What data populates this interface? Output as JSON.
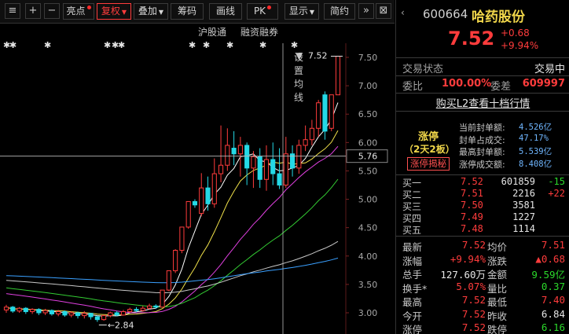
{
  "toolbar": {
    "icons": [
      "≡",
      "+",
      "−"
    ],
    "buttons": [
      {
        "label": "亮点",
        "dot": true
      },
      {
        "label": "复权",
        "active": true,
        "caret": true
      },
      {
        "label": "叠加",
        "caret": true
      },
      {
        "label": "筹码"
      },
      {
        "label": "画线"
      },
      {
        "label": "PK",
        "dot": true
      },
      {
        "label": "显示",
        "caret": true
      },
      {
        "label": "简约"
      }
    ],
    "more": "»",
    "window_icon": "⊠"
  },
  "subbar": {
    "items": [
      "沪股通",
      "融资融券",
      "设置均线"
    ]
  },
  "chart_data": {
    "type": "candlestick",
    "ylim": [
      2.8,
      7.7
    ],
    "y_ticks": [
      "7.50",
      "7.00",
      "6.50",
      "6.00",
      "5.50",
      "5.00",
      "4.50",
      "4.00",
      "3.50",
      "3.00"
    ],
    "crosshair_price": "5.76",
    "high_label": "7.52",
    "low_label": "2.84",
    "event_markers": "✱✱",
    "colors": {
      "up": "#ff3c3c",
      "down": "#24d9e6",
      "ma5": "#ffffff",
      "ma10": "#f0e14a",
      "ma20": "#e040e0",
      "ma30": "#33cc33",
      "ma60": "#c8c8c8",
      "ma120": "#3aa0ff"
    },
    "candles": [
      {
        "o": 3.05,
        "c": 3.1,
        "h": 3.14,
        "l": 3.0
      },
      {
        "o": 3.1,
        "c": 3.03,
        "h": 3.12,
        "l": 3.0
      },
      {
        "o": 3.03,
        "c": 3.08,
        "h": 3.1,
        "l": 3.0
      },
      {
        "o": 3.08,
        "c": 3.02,
        "h": 3.1,
        "l": 2.98
      },
      {
        "o": 3.02,
        "c": 3.06,
        "h": 3.08,
        "l": 2.98
      },
      {
        "o": 3.06,
        "c": 3.0,
        "h": 3.08,
        "l": 2.96
      },
      {
        "o": 3.0,
        "c": 3.04,
        "h": 3.07,
        "l": 2.96
      },
      {
        "o": 3.04,
        "c": 2.98,
        "h": 3.06,
        "l": 2.95
      },
      {
        "o": 2.98,
        "c": 3.02,
        "h": 3.05,
        "l": 2.94
      },
      {
        "o": 3.02,
        "c": 2.96,
        "h": 3.04,
        "l": 2.93
      },
      {
        "o": 2.96,
        "c": 3.0,
        "h": 3.03,
        "l": 2.92
      },
      {
        "o": 3.0,
        "c": 2.95,
        "h": 3.02,
        "l": 2.9
      },
      {
        "o": 2.95,
        "c": 2.99,
        "h": 3.03,
        "l": 2.9
      },
      {
        "o": 2.99,
        "c": 2.93,
        "h": 3.0,
        "l": 2.88
      },
      {
        "o": 2.93,
        "c": 2.88,
        "h": 2.95,
        "l": 2.84
      },
      {
        "o": 2.88,
        "c": 2.95,
        "h": 2.97,
        "l": 2.86
      },
      {
        "o": 2.95,
        "c": 3.0,
        "h": 3.02,
        "l": 2.92
      },
      {
        "o": 3.0,
        "c": 2.96,
        "h": 3.03,
        "l": 2.94
      },
      {
        "o": 2.96,
        "c": 3.02,
        "h": 3.05,
        "l": 2.95
      },
      {
        "o": 3.02,
        "c": 3.06,
        "h": 3.09,
        "l": 3.0
      },
      {
        "o": 3.06,
        "c": 3.04,
        "h": 3.1,
        "l": 3.01
      },
      {
        "o": 3.04,
        "c": 3.08,
        "h": 3.12,
        "l": 3.02
      },
      {
        "o": 3.08,
        "c": 3.12,
        "h": 3.16,
        "l": 3.06
      },
      {
        "o": 3.12,
        "c": 3.1,
        "h": 3.15,
        "l": 3.07
      },
      {
        "o": 3.1,
        "c": 3.4,
        "h": 3.4,
        "l": 3.09
      },
      {
        "o": 3.4,
        "c": 3.74,
        "h": 3.74,
        "l": 3.38
      },
      {
        "o": 3.74,
        "c": 4.1,
        "h": 4.12,
        "l": 3.7
      },
      {
        "o": 4.1,
        "c": 4.51,
        "h": 4.51,
        "l": 4.05
      },
      {
        "o": 4.51,
        "c": 4.96,
        "h": 4.96,
        "l": 4.48
      },
      {
        "o": 4.96,
        "c": 4.9,
        "h": 5.0,
        "l": 4.85
      },
      {
        "o": 4.75,
        "c": 5.2,
        "h": 5.46,
        "l": 4.7
      },
      {
        "o": 5.2,
        "c": 4.92,
        "h": 5.4,
        "l": 4.8
      },
      {
        "o": 4.92,
        "c": 5.45,
        "h": 5.72,
        "l": 4.85
      },
      {
        "o": 5.45,
        "c": 5.6,
        "h": 6.3,
        "l": 5.3
      },
      {
        "o": 5.6,
        "c": 5.95,
        "h": 6.25,
        "l": 5.5
      },
      {
        "o": 5.9,
        "c": 5.8,
        "h": 6.2,
        "l": 5.6
      },
      {
        "o": 5.8,
        "c": 5.95,
        "h": 6.1,
        "l": 5.4
      },
      {
        "o": 5.95,
        "c": 5.55,
        "h": 6.0,
        "l": 5.25
      },
      {
        "o": 5.55,
        "c": 5.75,
        "h": 5.85,
        "l": 5.2
      },
      {
        "o": 5.75,
        "c": 5.35,
        "h": 5.9,
        "l": 5.2
      },
      {
        "o": 5.35,
        "c": 5.7,
        "h": 5.95,
        "l": 5.15
      },
      {
        "o": 5.7,
        "c": 5.45,
        "h": 6.0,
        "l": 5.25
      },
      {
        "o": 5.45,
        "c": 5.25,
        "h": 5.9,
        "l": 5.18
      },
      {
        "o": 5.25,
        "c": 5.8,
        "h": 6.1,
        "l": 5.2
      },
      {
        "o": 5.8,
        "c": 5.55,
        "h": 5.95,
        "l": 5.4
      },
      {
        "o": 5.55,
        "c": 5.95,
        "h": 6.05,
        "l": 5.45
      },
      {
        "o": 5.95,
        "c": 6.05,
        "h": 6.3,
        "l": 5.85
      },
      {
        "o": 6.05,
        "c": 6.25,
        "h": 6.4,
        "l": 5.95
      },
      {
        "o": 6.25,
        "c": 6.7,
        "h": 6.75,
        "l": 6.1
      },
      {
        "o": 6.84,
        "c": 6.2,
        "h": 6.9,
        "l": 6.05
      },
      {
        "o": 6.25,
        "c": 6.84,
        "h": 6.84,
        "l": 6.2
      },
      {
        "o": 6.84,
        "c": 7.52,
        "h": 7.52,
        "l": 6.84
      }
    ]
  },
  "quote": {
    "code": "600664",
    "name": "哈药股份",
    "price": "7.52",
    "change": "+0.68",
    "change_pct": "+9.94%",
    "trade_status_label": "交易状态",
    "trade_status_value": "交易中",
    "wei_bi_label": "委比",
    "wei_bi_value": "100.00%",
    "wei_cha_label": "委差",
    "wei_cha_value": "609997",
    "buy_l2_link": "购买L2查看十档行情",
    "limit_title": "涨停",
    "limit_days": "（2天2板）",
    "limit_button": "涨停揭秘",
    "seal_stats": [
      {
        "label": "当前封单额:",
        "value": "4.526亿"
      },
      {
        "label": "封单占成交:",
        "value": "47.17%"
      },
      {
        "label": "最高封单额:",
        "value": "5.539亿"
      },
      {
        "label": "涨停成交额:",
        "value": "8.408亿"
      }
    ],
    "book": [
      {
        "label": "买一",
        "price": "7.52",
        "vol": "601859",
        "chg": "-15"
      },
      {
        "label": "买二",
        "price": "7.51",
        "vol": "2216",
        "chg": "+22"
      },
      {
        "label": "买三",
        "price": "7.50",
        "vol": "3581",
        "chg": ""
      },
      {
        "label": "买四",
        "price": "7.49",
        "vol": "1227",
        "chg": ""
      },
      {
        "label": "买五",
        "price": "7.48",
        "vol": "1114",
        "chg": ""
      }
    ],
    "stats": [
      {
        "l1": "最新",
        "v1": "7.52",
        "l2": "均价",
        "v2": "7.51"
      },
      {
        "l1": "涨幅",
        "v1": "+9.94%",
        "l2": "涨跌",
        "v2": "▲0.68"
      },
      {
        "l1": "总手",
        "v1": "127.60万",
        "l2": "金额",
        "v2": "9.59亿"
      },
      {
        "l1": "换手*",
        "v1": "5.07%",
        "l2": "量比",
        "v2": "0.37"
      },
      {
        "l1": "最高",
        "v1": "7.52",
        "l2": "最低",
        "v2": "7.40"
      },
      {
        "l1": "今开",
        "v1": "7.52",
        "l2": "昨收",
        "v2": "6.84"
      },
      {
        "l1": "涨停",
        "v1": "7.52",
        "l2": "跌停",
        "v2": "6.16"
      }
    ]
  }
}
